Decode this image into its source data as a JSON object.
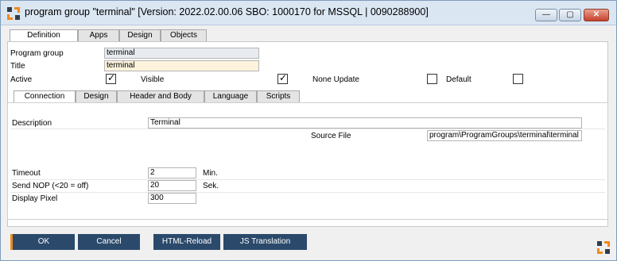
{
  "window": {
    "title": "program group \"terminal\" [Version: 2022.02.00.06 SBO: 1000170 for MSSQL | 0090288900]",
    "minimize_glyph": "—",
    "maximize_glyph": "▢",
    "close_glyph": "✕"
  },
  "top_tabs": [
    "Definition",
    "Apps",
    "Design",
    "Objects"
  ],
  "definition": {
    "program_group_label": "Program group",
    "program_group_value": "terminal",
    "title_label": "Title",
    "title_value": "terminal",
    "active_label": "Active",
    "active_checked": "✓",
    "visible_label": "Visible",
    "visible_checked": "✓",
    "none_update_label": "None Update",
    "default_label": "Default"
  },
  "sub_tabs": [
    "Connection",
    "Design",
    "Header and Body",
    "Language",
    "Scripts"
  ],
  "connection": {
    "description_label": "Description",
    "description_value": "Terminal",
    "source_file_label": "Source File",
    "source_file_value": "program\\ProgramGroups\\terminal\\terminal",
    "timeout_label": "Timeout",
    "timeout_value": "2",
    "timeout_unit": "Min.",
    "nop_label": "Send NOP (<20 = off)",
    "nop_value": "20",
    "nop_unit": "Sek.",
    "pixel_label": "Display Pixel",
    "pixel_value": "300"
  },
  "buttons": {
    "ok": "OK",
    "cancel": "Cancel",
    "html_reload": "HTML-Reload",
    "js_translation": "JS Translation"
  }
}
